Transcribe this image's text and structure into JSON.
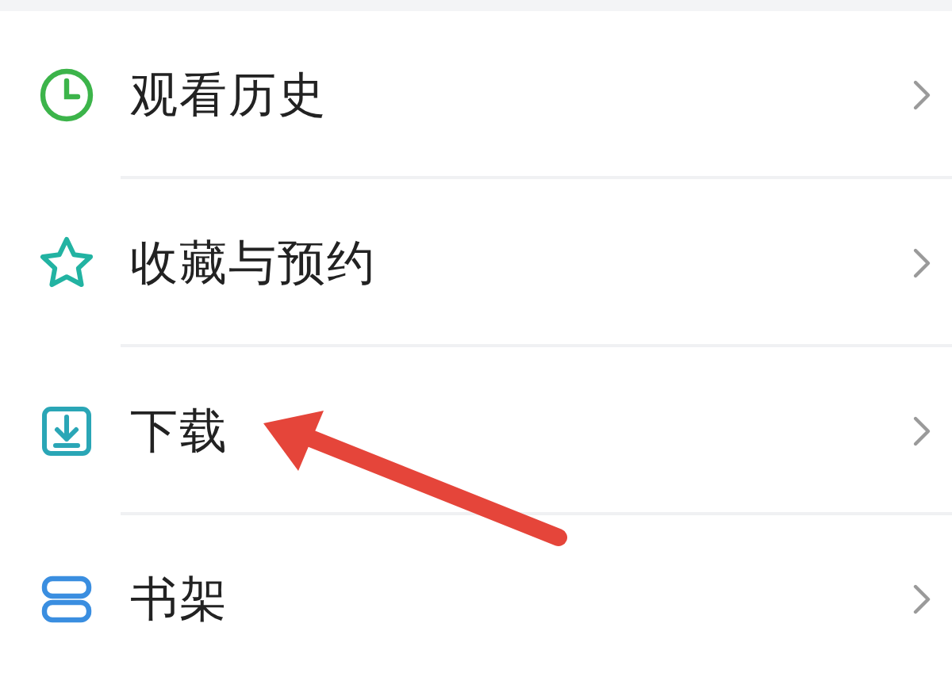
{
  "menu": [
    {
      "kind": "history",
      "label": "观看历史"
    },
    {
      "kind": "favorites",
      "label": "收藏与预约"
    },
    {
      "kind": "download",
      "label": "下载"
    },
    {
      "kind": "shelf",
      "label": "书架"
    }
  ]
}
